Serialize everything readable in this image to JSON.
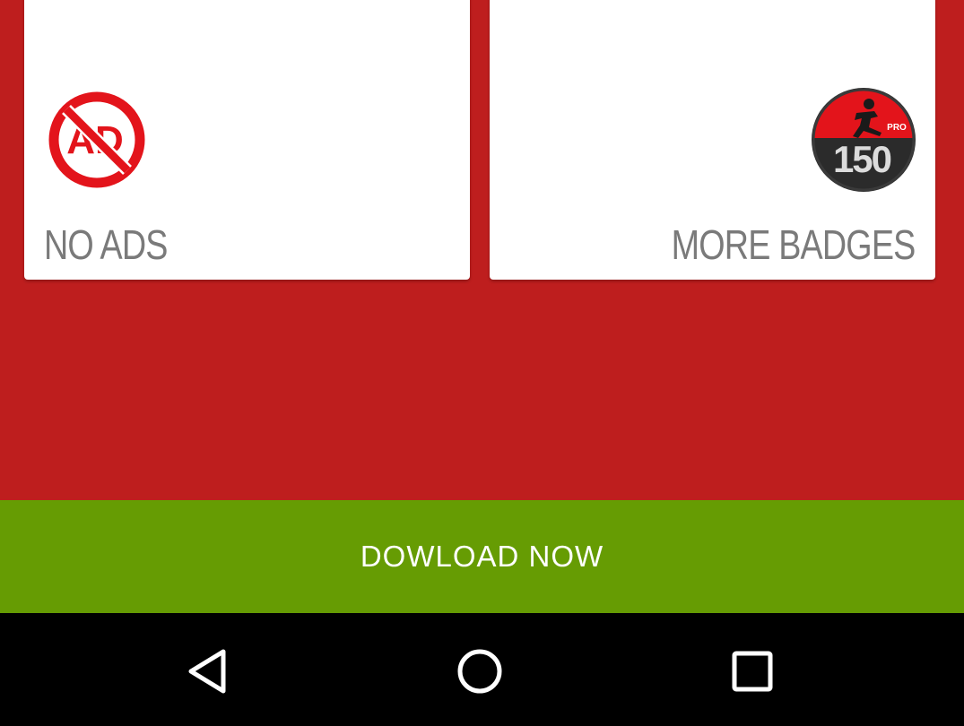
{
  "colors": {
    "background": "#be1e1e",
    "card": "#ffffff",
    "label_gray": "#7a7a7a",
    "download_bar": "#669c03",
    "nav_bar": "#000000",
    "icon_red": "#e3141b"
  },
  "features": {
    "no_ads": {
      "icon": "no-ads-icon",
      "icon_text": "AD",
      "label": "NO ADS"
    },
    "more_badges": {
      "icon": "badge-150-pro-icon",
      "badge_number": "150",
      "badge_tag": "PRO",
      "label": "MORE BADGES"
    }
  },
  "download": {
    "label": "DOWLOAD NOW"
  },
  "navigation": {
    "back": "back-icon",
    "home": "home-icon",
    "recents": "recents-icon"
  }
}
